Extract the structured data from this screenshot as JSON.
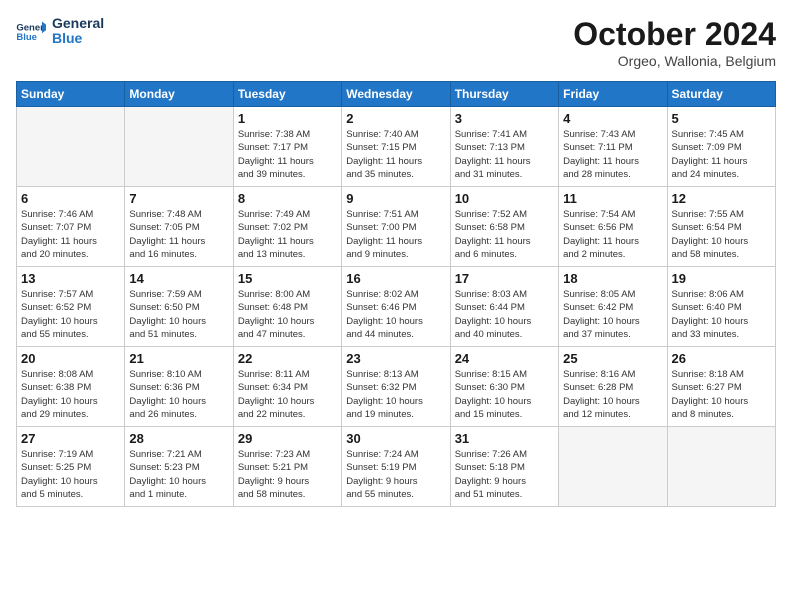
{
  "logo": {
    "general": "General",
    "blue": "Blue"
  },
  "header": {
    "month": "October 2024",
    "location": "Orgeo, Wallonia, Belgium"
  },
  "columns": [
    "Sunday",
    "Monday",
    "Tuesday",
    "Wednesday",
    "Thursday",
    "Friday",
    "Saturday"
  ],
  "weeks": [
    [
      {
        "num": "",
        "detail": "",
        "empty": true
      },
      {
        "num": "",
        "detail": "",
        "empty": true
      },
      {
        "num": "1",
        "detail": "Sunrise: 7:38 AM\nSunset: 7:17 PM\nDaylight: 11 hours\nand 39 minutes."
      },
      {
        "num": "2",
        "detail": "Sunrise: 7:40 AM\nSunset: 7:15 PM\nDaylight: 11 hours\nand 35 minutes."
      },
      {
        "num": "3",
        "detail": "Sunrise: 7:41 AM\nSunset: 7:13 PM\nDaylight: 11 hours\nand 31 minutes."
      },
      {
        "num": "4",
        "detail": "Sunrise: 7:43 AM\nSunset: 7:11 PM\nDaylight: 11 hours\nand 28 minutes."
      },
      {
        "num": "5",
        "detail": "Sunrise: 7:45 AM\nSunset: 7:09 PM\nDaylight: 11 hours\nand 24 minutes."
      }
    ],
    [
      {
        "num": "6",
        "detail": "Sunrise: 7:46 AM\nSunset: 7:07 PM\nDaylight: 11 hours\nand 20 minutes."
      },
      {
        "num": "7",
        "detail": "Sunrise: 7:48 AM\nSunset: 7:05 PM\nDaylight: 11 hours\nand 16 minutes."
      },
      {
        "num": "8",
        "detail": "Sunrise: 7:49 AM\nSunset: 7:02 PM\nDaylight: 11 hours\nand 13 minutes."
      },
      {
        "num": "9",
        "detail": "Sunrise: 7:51 AM\nSunset: 7:00 PM\nDaylight: 11 hours\nand 9 minutes."
      },
      {
        "num": "10",
        "detail": "Sunrise: 7:52 AM\nSunset: 6:58 PM\nDaylight: 11 hours\nand 6 minutes."
      },
      {
        "num": "11",
        "detail": "Sunrise: 7:54 AM\nSunset: 6:56 PM\nDaylight: 11 hours\nand 2 minutes."
      },
      {
        "num": "12",
        "detail": "Sunrise: 7:55 AM\nSunset: 6:54 PM\nDaylight: 10 hours\nand 58 minutes."
      }
    ],
    [
      {
        "num": "13",
        "detail": "Sunrise: 7:57 AM\nSunset: 6:52 PM\nDaylight: 10 hours\nand 55 minutes."
      },
      {
        "num": "14",
        "detail": "Sunrise: 7:59 AM\nSunset: 6:50 PM\nDaylight: 10 hours\nand 51 minutes."
      },
      {
        "num": "15",
        "detail": "Sunrise: 8:00 AM\nSunset: 6:48 PM\nDaylight: 10 hours\nand 47 minutes."
      },
      {
        "num": "16",
        "detail": "Sunrise: 8:02 AM\nSunset: 6:46 PM\nDaylight: 10 hours\nand 44 minutes."
      },
      {
        "num": "17",
        "detail": "Sunrise: 8:03 AM\nSunset: 6:44 PM\nDaylight: 10 hours\nand 40 minutes."
      },
      {
        "num": "18",
        "detail": "Sunrise: 8:05 AM\nSunset: 6:42 PM\nDaylight: 10 hours\nand 37 minutes."
      },
      {
        "num": "19",
        "detail": "Sunrise: 8:06 AM\nSunset: 6:40 PM\nDaylight: 10 hours\nand 33 minutes."
      }
    ],
    [
      {
        "num": "20",
        "detail": "Sunrise: 8:08 AM\nSunset: 6:38 PM\nDaylight: 10 hours\nand 29 minutes."
      },
      {
        "num": "21",
        "detail": "Sunrise: 8:10 AM\nSunset: 6:36 PM\nDaylight: 10 hours\nand 26 minutes."
      },
      {
        "num": "22",
        "detail": "Sunrise: 8:11 AM\nSunset: 6:34 PM\nDaylight: 10 hours\nand 22 minutes."
      },
      {
        "num": "23",
        "detail": "Sunrise: 8:13 AM\nSunset: 6:32 PM\nDaylight: 10 hours\nand 19 minutes."
      },
      {
        "num": "24",
        "detail": "Sunrise: 8:15 AM\nSunset: 6:30 PM\nDaylight: 10 hours\nand 15 minutes."
      },
      {
        "num": "25",
        "detail": "Sunrise: 8:16 AM\nSunset: 6:28 PM\nDaylight: 10 hours\nand 12 minutes."
      },
      {
        "num": "26",
        "detail": "Sunrise: 8:18 AM\nSunset: 6:27 PM\nDaylight: 10 hours\nand 8 minutes."
      }
    ],
    [
      {
        "num": "27",
        "detail": "Sunrise: 7:19 AM\nSunset: 5:25 PM\nDaylight: 10 hours\nand 5 minutes."
      },
      {
        "num": "28",
        "detail": "Sunrise: 7:21 AM\nSunset: 5:23 PM\nDaylight: 10 hours\nand 1 minute."
      },
      {
        "num": "29",
        "detail": "Sunrise: 7:23 AM\nSunset: 5:21 PM\nDaylight: 9 hours\nand 58 minutes."
      },
      {
        "num": "30",
        "detail": "Sunrise: 7:24 AM\nSunset: 5:19 PM\nDaylight: 9 hours\nand 55 minutes."
      },
      {
        "num": "31",
        "detail": "Sunrise: 7:26 AM\nSunset: 5:18 PM\nDaylight: 9 hours\nand 51 minutes."
      },
      {
        "num": "",
        "detail": "",
        "empty": true
      },
      {
        "num": "",
        "detail": "",
        "empty": true
      }
    ]
  ]
}
